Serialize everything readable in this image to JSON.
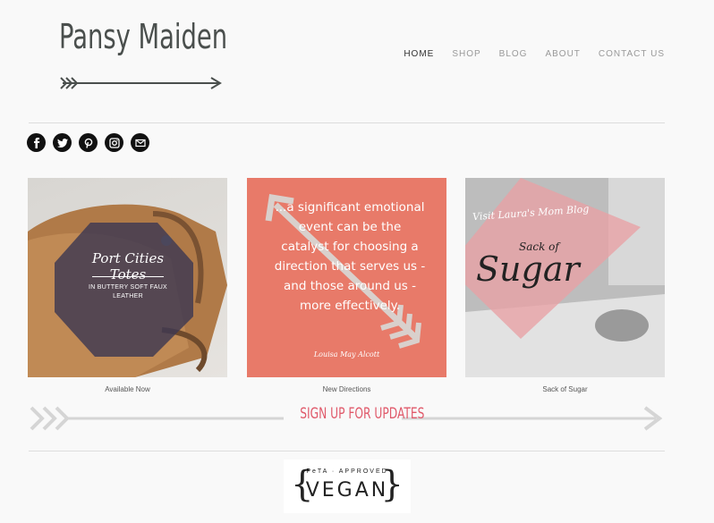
{
  "brand": {
    "name": "Pansy Maiden"
  },
  "nav": {
    "items": [
      {
        "label": "HOME",
        "active": true
      },
      {
        "label": "SHOP",
        "active": false
      },
      {
        "label": "BLOG",
        "active": false
      },
      {
        "label": "ABOUT",
        "active": false
      },
      {
        "label": "CONTACT US",
        "active": false
      }
    ]
  },
  "social": [
    "facebook-icon",
    "twitter-icon",
    "pinterest-icon",
    "instagram-icon",
    "email-icon"
  ],
  "tiles": [
    {
      "title": "Port Cities Totes",
      "subtitle": "IN BUTTERY SOFT FAUX LEATHER",
      "caption": "Available Now"
    },
    {
      "quote": "...a significant emotional event can be the catalyst for choosing a direction that serves us - and those around us - more effectively.",
      "author": "Louisa May Alcott",
      "caption": "New Directions"
    },
    {
      "script": "Visit Laura's Mom Blog",
      "sack": "Sack of",
      "sugar": "Sugar",
      "caption": "Sack of Sugar"
    }
  ],
  "signup": {
    "label": "SIGN UP FOR UPDATES"
  },
  "badge": {
    "top": "PeTA · APPROVED",
    "main": "VEGAN"
  },
  "colors": {
    "accent": "#e0596a",
    "quote_bg": "#e87a69",
    "logo": "#4a4f4d"
  }
}
